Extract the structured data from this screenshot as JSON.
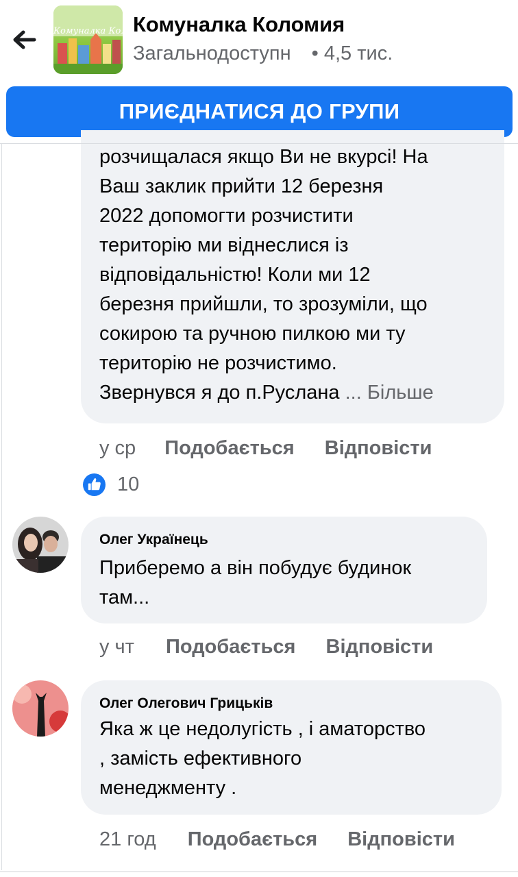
{
  "header": {
    "group_name": "Комуналка Коломия",
    "visibility": "Загальнодоступн",
    "members": "• 4,5 тис.",
    "thumbnail_text": "Комуналка Коломия",
    "join_label": "ПРИЄДНАТИСЯ ДО ГРУПИ",
    "accent_color": "#1877f2"
  },
  "icons": {
    "back": "back-arrow-icon",
    "like": "like-thumb-icon"
  },
  "comments": [
    {
      "lines": [
        "розчищалася якщо Ви не вкурсі! На",
        "Ваш заклик прийти 12 березня",
        "2022 допомогти розчистити",
        "територію ми віднеслися із",
        "відповідальністю! Коли ми 12",
        "березня прийшли, то зрозуміли, що",
        "сокирою та ручною пилкою ми ту",
        "територію не розчистимо.",
        "Звернувся я до п.Руслана"
      ],
      "more_label": "... Більше",
      "time": "у ср",
      "like_label": "Подобається",
      "reply_label": "Відповісти",
      "reactions": "10"
    },
    {
      "author": "Олег Українець",
      "lines": [
        "Приберемо а він побудує будинок",
        "там..."
      ],
      "time": "у чт",
      "like_label": "Подобається",
      "reply_label": "Відповісти"
    },
    {
      "author": "Олег Олегович Грицьків",
      "lines": [
        "Яка ж це недолугість , і аматорство",
        ", замість ефективного",
        "менеджменту ."
      ],
      "time": "21 год",
      "like_label": "Подобається",
      "reply_label": "Відповісти"
    }
  ]
}
